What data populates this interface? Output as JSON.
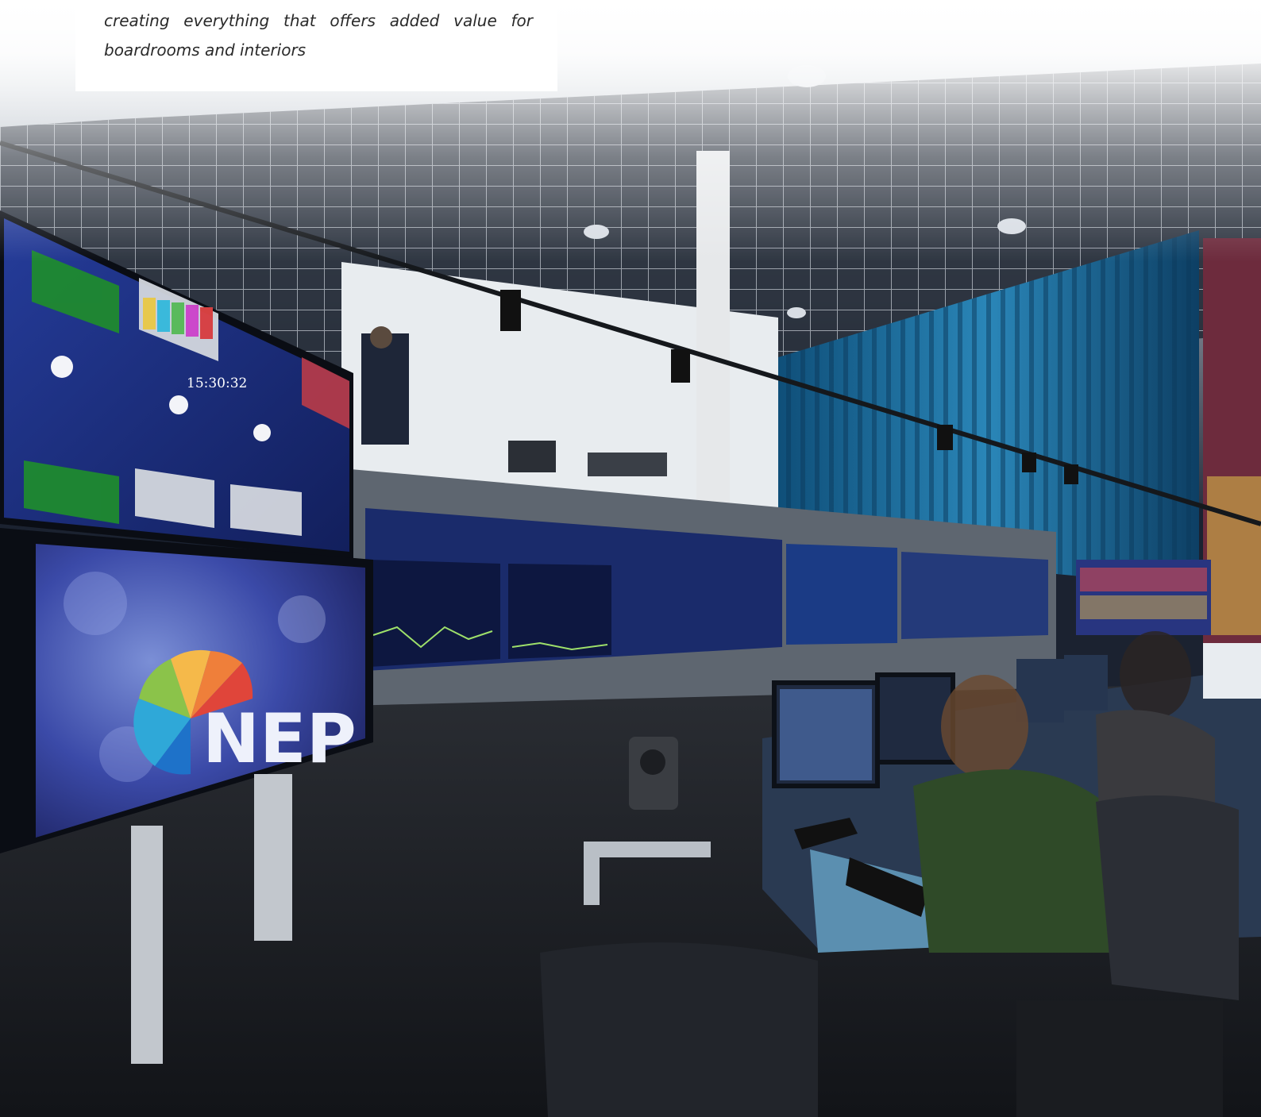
{
  "caption": {
    "text": "creating everything that offers added value for boardrooms and interiors"
  },
  "photo": {
    "logo_text": "NEP",
    "clock_text": "15:30:32"
  },
  "colors": {
    "caption_background": "#ffffff",
    "caption_text": "#2a2a2a",
    "ceiling_light": "#d8dde4",
    "curtain_blue": "#1f6f9c",
    "monitor_blue": "#1c2c78",
    "floor_dark": "#1a1d22"
  }
}
